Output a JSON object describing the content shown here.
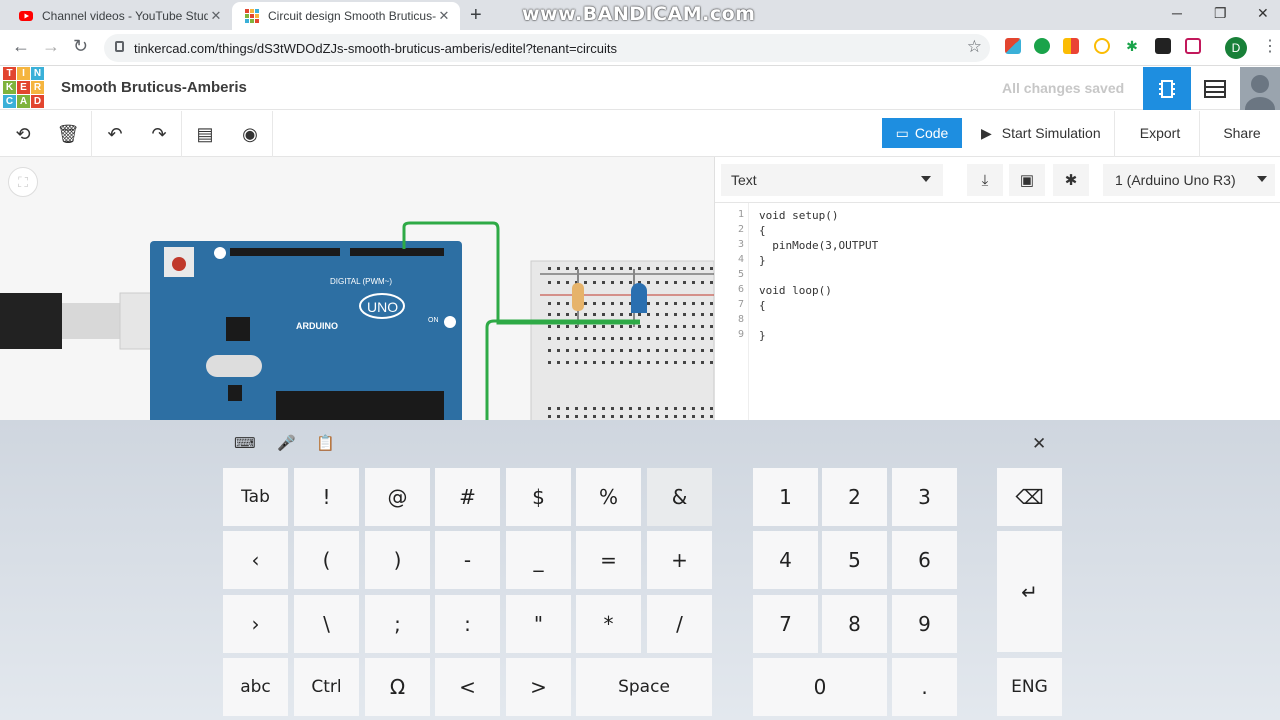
{
  "browser": {
    "tabs": [
      {
        "title": "Channel videos - YouTube Studio",
        "active": false
      },
      {
        "title": "Circuit design Smooth Bruticus-A",
        "active": true
      }
    ],
    "watermark": "www.BANDICAM.com",
    "url": "tinkercad.com/things/dS3tWDOdZJs-smooth-bruticus-amberis/editel?tenant=circuits",
    "profile_initial": "D"
  },
  "app": {
    "logo_letters": [
      "T",
      "I",
      "N",
      "K",
      "E",
      "R",
      "C",
      "A",
      "D"
    ],
    "project_name": "Smooth Bruticus-Amberis",
    "save_status": "All changes saved"
  },
  "toolbar": {
    "code_label": "Code",
    "simulate_label": "Start Simulation",
    "export_label": "Export",
    "share_label": "Share"
  },
  "code_panel": {
    "mode": "Text",
    "device": "1 (Arduino Uno R3)",
    "lines": [
      {
        "n": "1",
        "text": "void setup()"
      },
      {
        "n": "2",
        "text": "{"
      },
      {
        "n": "3",
        "text": "  pinMode(3,OUTPUT"
      },
      {
        "n": "4",
        "text": "}"
      },
      {
        "n": "5",
        "text": ""
      },
      {
        "n": "6",
        "text": "void loop()"
      },
      {
        "n": "7",
        "text": "{"
      },
      {
        "n": "8",
        "text": ""
      },
      {
        "n": "9",
        "text": "}"
      }
    ]
  },
  "circuit": {
    "board_brand": "ARDUINO",
    "board_model": "UNO",
    "digital_label": "DIGITAL (PWM~)",
    "on_label": "ON"
  },
  "keyboard": {
    "left_rows": [
      [
        "Tab",
        "!",
        "@",
        "#",
        "$",
        "%",
        "&"
      ],
      [
        "‹",
        "(",
        ")",
        "-",
        "_",
        "=",
        "+"
      ],
      [
        "›",
        "\\",
        ";",
        ":",
        "\"",
        "*",
        "/"
      ],
      [
        "abc",
        "Ctrl",
        "Ω",
        "<",
        ">",
        "Space"
      ]
    ],
    "num_rows": [
      [
        "1",
        "2",
        "3"
      ],
      [
        "4",
        "5",
        "6"
      ],
      [
        "7",
        "8",
        "9"
      ],
      [
        "0",
        "."
      ]
    ],
    "backspace": "⌫",
    "enter": "↵",
    "lang": "ENG",
    "close": "✕"
  },
  "colors": {
    "accent": "#1e8ee0",
    "board": "#2d6fa3",
    "wire": "#2eaa46",
    "logo": [
      "#e2452f",
      "#f5b53f",
      "#3ab0d8",
      "#7fb33c",
      "#e2452f",
      "#f5b53f",
      "#3ab0d8",
      "#7fb33c",
      "#e2452f"
    ]
  }
}
